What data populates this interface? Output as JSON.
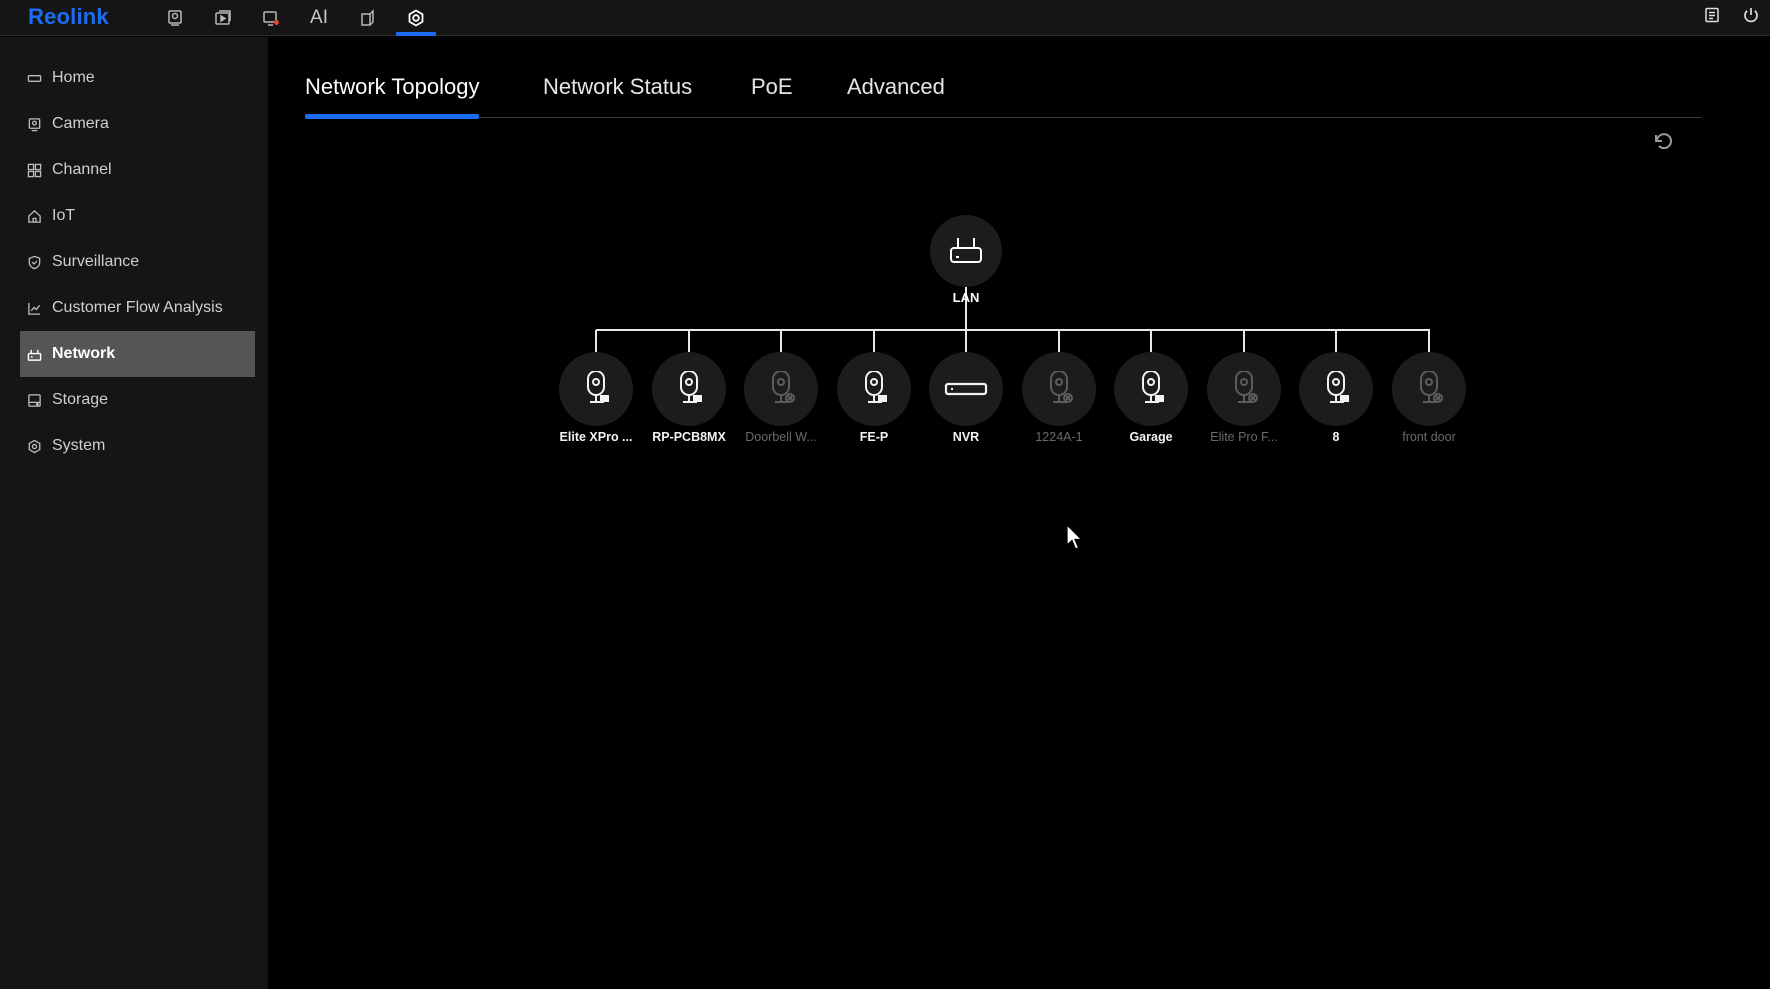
{
  "app": {
    "logo": "Reolink"
  },
  "topnav": {
    "ai_label": "AI"
  },
  "sidebar": {
    "items": [
      {
        "label": "Home",
        "icon": "home-icon"
      },
      {
        "label": "Camera",
        "icon": "camera-icon"
      },
      {
        "label": "Channel",
        "icon": "channel-grid-icon"
      },
      {
        "label": "IoT",
        "icon": "iot-house-icon"
      },
      {
        "label": "Surveillance",
        "icon": "shield-icon"
      },
      {
        "label": "Customer Flow Analysis",
        "icon": "chart-icon"
      },
      {
        "label": "Network",
        "icon": "network-icon",
        "active": true
      },
      {
        "label": "Storage",
        "icon": "storage-icon"
      },
      {
        "label": "System",
        "icon": "gear-icon"
      }
    ]
  },
  "tabs": [
    {
      "label": "Network Topology",
      "active": true
    },
    {
      "label": "Network Status"
    },
    {
      "label": "PoE"
    },
    {
      "label": "Advanced"
    }
  ],
  "topology": {
    "root": {
      "label": "LAN",
      "icon": "router-icon"
    },
    "devices": [
      {
        "label": "Elite XPro ...",
        "type": "camera",
        "status": "online"
      },
      {
        "label": "RP-PCB8MX",
        "type": "camera",
        "status": "online"
      },
      {
        "label": "Doorbell W...",
        "type": "camera",
        "status": "offline"
      },
      {
        "label": "FE-P",
        "type": "camera",
        "status": "online"
      },
      {
        "label": "NVR",
        "type": "nvr",
        "status": "online"
      },
      {
        "label": "1224A-1",
        "type": "camera",
        "status": "offline"
      },
      {
        "label": "Garage",
        "type": "camera",
        "status": "online"
      },
      {
        "label": "Elite Pro F...",
        "type": "camera",
        "status": "offline"
      },
      {
        "label": "8",
        "type": "camera",
        "status": "online"
      },
      {
        "label": "front door",
        "type": "camera",
        "status": "offline"
      }
    ]
  },
  "colors": {
    "accent": "#1a6cf0",
    "background": "#000000",
    "sidebar": "#151515",
    "active_item": "#555555",
    "online": "#f2f2f2",
    "offline": "#5c5c5c"
  }
}
